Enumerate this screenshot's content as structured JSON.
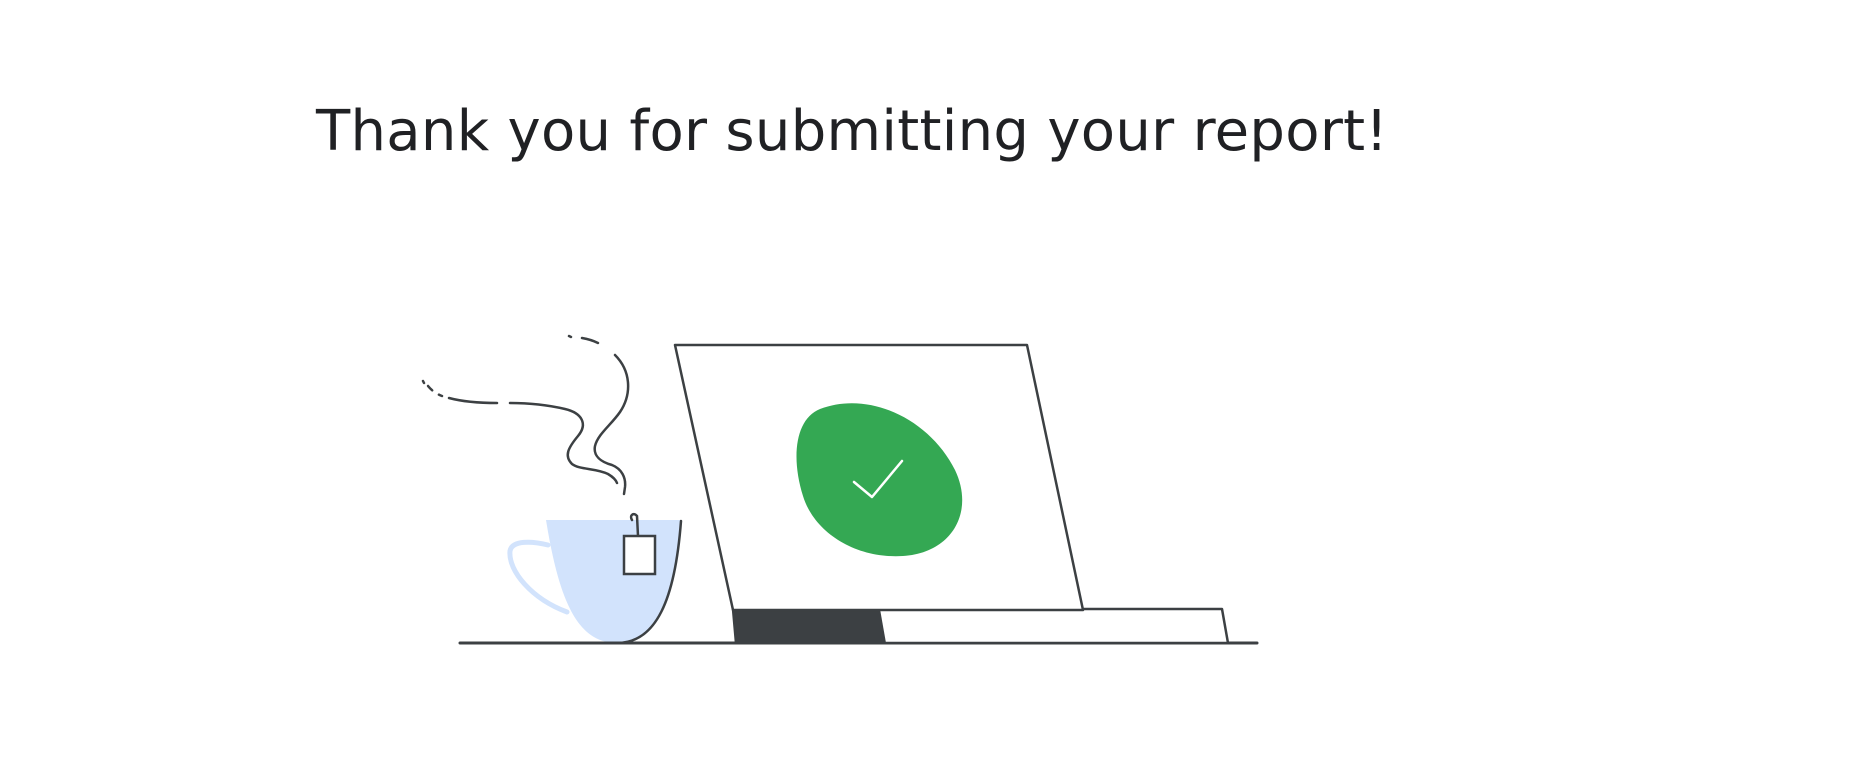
{
  "confirmation": {
    "title": "Thank you for submitting your report!"
  },
  "illustration": {
    "status_icon": "checkmark-icon",
    "colors": {
      "success_green": "#34a853",
      "cup_fill": "#d2e3fc",
      "line": "#3c4043",
      "laptop_base_dark": "#3c4043"
    }
  }
}
